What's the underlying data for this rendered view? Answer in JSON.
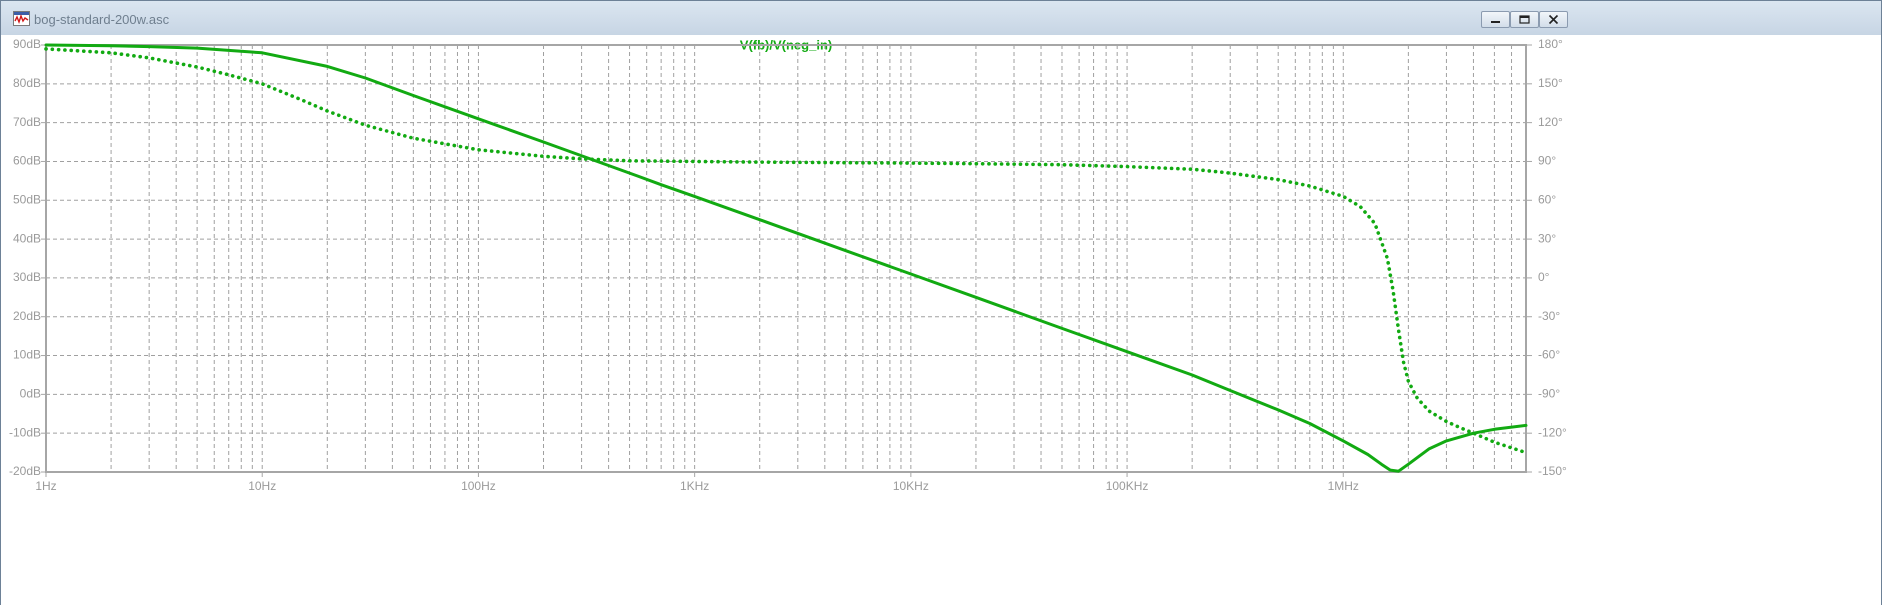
{
  "window": {
    "title": "bog-standard-200w.asc",
    "controls": [
      "minimize",
      "restore",
      "close"
    ]
  },
  "plot": {
    "colors": {
      "trace": "#12aa12",
      "grid": "#a0a0a0",
      "frame": "#a6a6a6",
      "label": "#9a9a9a"
    },
    "trace_title": "V(fb)/V(neg_in)"
  },
  "chart_data": {
    "type": "line",
    "title": "V(fb)/V(neg_in)",
    "x_scale": "log",
    "xlim": [
      1,
      7000000
    ],
    "x_ticks": [
      {
        "value": 1,
        "label": "1Hz"
      },
      {
        "value": 10,
        "label": "10Hz"
      },
      {
        "value": 100,
        "label": "100Hz"
      },
      {
        "value": 1000,
        "label": "1KHz"
      },
      {
        "value": 10000,
        "label": "10KHz"
      },
      {
        "value": 100000,
        "label": "100KHz"
      },
      {
        "value": 1000000,
        "label": "1MHz"
      }
    ],
    "ylim_left": [
      -20,
      90
    ],
    "y_ticks_left": [
      "90dB",
      "80dB",
      "70dB",
      "60dB",
      "50dB",
      "40dB",
      "30dB",
      "20dB",
      "10dB",
      "0dB",
      "-10dB",
      "-20dB"
    ],
    "ylim_right": [
      -150,
      180
    ],
    "y_ticks_right": [
      "180°",
      "150°",
      "120°",
      "90°",
      "60°",
      "30°",
      "0°",
      "-30°",
      "-60°",
      "-90°",
      "-120°",
      "-150°"
    ],
    "grid": true,
    "series": [
      {
        "role": "magnitude",
        "axis": "left",
        "style": "solid",
        "x": [
          1,
          2,
          3,
          5,
          10,
          20,
          30,
          50,
          100,
          200,
          500,
          700,
          1000,
          2000,
          5000,
          10000,
          20000,
          50000,
          100000,
          200000,
          300000,
          500000,
          700000,
          1000000,
          1300000,
          1500000,
          1650000,
          1800000,
          2000000,
          2500000,
          3000000,
          4000000,
          5000000,
          7000000
        ],
        "y": [
          90,
          89.8,
          89.6,
          89.2,
          88,
          84.5,
          81.5,
          77,
          71,
          65,
          57,
          54,
          51,
          45,
          37,
          31,
          25,
          17,
          11,
          5,
          1,
          -4,
          -7.5,
          -12,
          -15.5,
          -18,
          -19.5,
          -19.8,
          -18,
          -14,
          -12,
          -10,
          -9,
          -8
        ]
      },
      {
        "role": "phase",
        "axis": "right",
        "style": "dotted",
        "x": [
          1,
          2,
          3,
          5,
          7,
          10,
          15,
          20,
          30,
          50,
          100,
          200,
          300,
          500,
          700,
          1000,
          2000,
          5000,
          10000,
          20000,
          50000,
          100000,
          200000,
          300000,
          500000,
          700000,
          1000000,
          1200000,
          1400000,
          1600000,
          1700000,
          1800000,
          1900000,
          2000000,
          2200000,
          2500000,
          3000000,
          3500000,
          4000000,
          5000000,
          7000000
        ],
        "y": [
          177,
          174,
          170,
          163,
          157,
          150,
          138,
          129,
          118,
          108,
          99,
          94,
          92,
          90.5,
          90.3,
          90,
          89.5,
          89,
          88.7,
          88.3,
          87.5,
          86,
          84,
          81,
          76,
          71,
          63,
          55,
          42,
          15,
          -10,
          -40,
          -65,
          -80,
          -93,
          -103,
          -111,
          -116,
          -120,
          -127,
          -135
        ]
      }
    ]
  }
}
